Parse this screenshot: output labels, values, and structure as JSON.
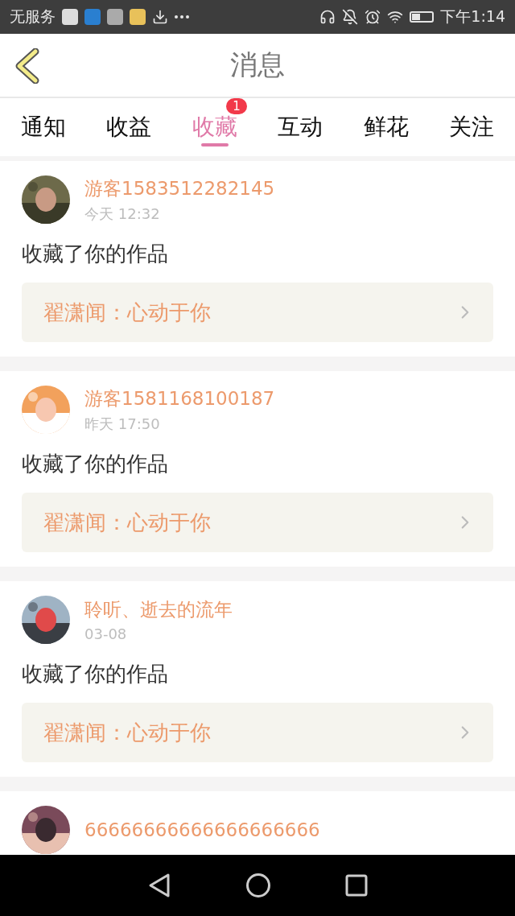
{
  "status_bar": {
    "carrier": "无服务",
    "time": "下午1:14"
  },
  "header": {
    "title": "消息"
  },
  "tabs": [
    {
      "label": "通知",
      "selected": false
    },
    {
      "label": "收益",
      "selected": false
    },
    {
      "label": "收藏",
      "selected": true,
      "badge": "1"
    },
    {
      "label": "互动",
      "selected": false
    },
    {
      "label": "鲜花",
      "selected": false
    },
    {
      "label": "关注",
      "selected": false
    }
  ],
  "messages": [
    {
      "user": "游客1583512282145",
      "time": "今天 12:32",
      "text": "收藏了你的作品",
      "work": "翟潇闻：心动于你"
    },
    {
      "user": "游客1581168100187",
      "time": "昨天 17:50",
      "text": "收藏了你的作品",
      "work": "翟潇闻：心动于你"
    },
    {
      "user": "聆听、逝去的流年",
      "time": "03-08",
      "text": "收藏了你的作品",
      "work": "翟潇闻：心动于你"
    },
    {
      "user": "66666666666666666666"
    }
  ]
}
